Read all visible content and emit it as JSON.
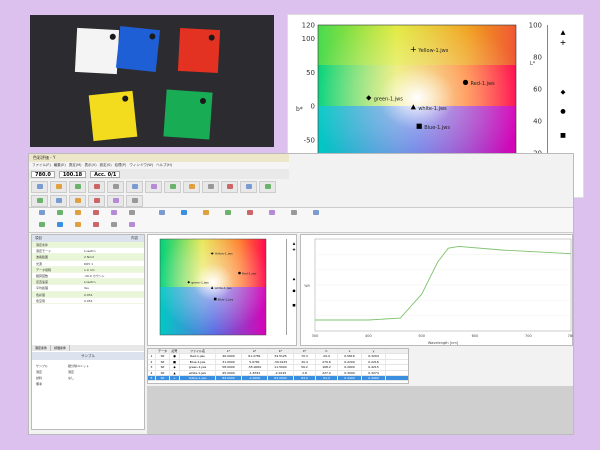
{
  "chips": [
    {
      "name": "white",
      "color": "#f4f4f4"
    },
    {
      "name": "blue",
      "color": "#1f5fd6"
    },
    {
      "name": "red",
      "color": "#e33222"
    },
    {
      "name": "yellow",
      "color": "#f3dc1e"
    },
    {
      "name": "green",
      "color": "#18ad55"
    }
  ],
  "big_chart": {
    "y_ticks": [
      "120",
      "100",
      "50",
      "0",
      "-50",
      "-100",
      "-120"
    ],
    "x_ticks": [
      "-120",
      "-100",
      "0",
      "100",
      "120"
    ],
    "y_label": "b*",
    "x_label": "a*",
    "l_label": "L*",
    "l_ticks": [
      "100",
      "80",
      "60",
      "40",
      "20",
      "0"
    ],
    "points": [
      {
        "label": "Yellow-1.jws",
        "a": -2,
        "b": 84,
        "marker": "plus",
        "L": 89
      },
      {
        "label": "Red-1.jws",
        "a": 60,
        "b": 35,
        "marker": "circle",
        "L": 46
      },
      {
        "label": "green-1.jws",
        "a": -55,
        "b": 12,
        "marker": "diamond",
        "L": 58
      },
      {
        "label": "white-1.jws",
        "a": -2,
        "b": -2,
        "marker": "triangle",
        "L": 95
      },
      {
        "label": "Blue-1.jws",
        "a": 5,
        "b": -30,
        "marker": "square",
        "L": 31
      }
    ]
  },
  "window": {
    "title": "色彩評価 - Y",
    "menu": [
      "ファイル(F)",
      "編集(E)",
      "測定(M)",
      "表示(V)",
      "設定(S)",
      "処理(P)",
      "ウィンドウ(W)",
      "ヘルプ(H)"
    ],
    "readout": {
      "wavelength": "780.0",
      "value": "100.18",
      "acc": "Acc. 0/1"
    },
    "left_panel": {
      "header_left": "項目",
      "header_right": "内容",
      "rows": [
        {
          "k": "測定条件",
          "v": ""
        },
        {
          "k": "測定モード",
          "v": "Lnsefcn"
        },
        {
          "k": "波長範囲",
          "v": "2 Nmd"
        },
        {
          "k": "光源",
          "v": "D65 1"
        },
        {
          "k": "データ間隔",
          "v": "1.0 nm"
        },
        {
          "k": "積算回数",
          "v": "-30.0 カウント"
        },
        {
          "k": "走査速度",
          "v": "Lnsefcn"
        },
        {
          "k": "平均処理",
          "v": "Yes"
        },
        {
          "k": "色彩値",
          "v": "0.051"
        },
        {
          "k": "色空間",
          "v": "0.051"
        }
      ],
      "tabs": [
        "測定条件",
        "評価条件"
      ],
      "sub_title": "サンプル",
      "info": [
        {
          "k": "サンプル",
          "v": "積分球ユニット"
        },
        {
          "k": "測定",
          "v": "測定"
        },
        {
          "k": "試料",
          "v": "なし"
        },
        {
          "k": "備考",
          "v": ""
        }
      ]
    },
    "spectrum": {
      "x_label": "Wavelength [nm]",
      "y_label": "%R",
      "x_ticks": [
        "300",
        "400",
        "500",
        "600",
        "700",
        "780"
      ],
      "curve_color": "#7fc36e"
    },
    "table": {
      "headers": [
        "",
        "データ",
        "記号",
        "ファイル名",
        "L*",
        "a*",
        "b*",
        "C*",
        "h",
        "x",
        "y"
      ],
      "rows": [
        [
          "1",
          "SP",
          "●",
          "Red-1.jws",
          "46.0000",
          "61.2781",
          "34.5125",
          "70.3",
          "29.4",
          "0.5616",
          "0.3294"
        ],
        [
          "2",
          "SP",
          "■",
          "Blue-1.jws",
          "31.0000",
          "5.0781",
          "-30.0125",
          "30.4",
          "279.6",
          "0.2200",
          "0.2216"
        ],
        [
          "3",
          "SP",
          "◆",
          "green-1.jws",
          "58.0000",
          "-55.0000",
          "11.5000",
          "56.2",
          "168.2",
          "0.2600",
          "0.4215"
        ],
        [
          "4",
          "SP",
          "▲",
          "white-1.jws",
          "95.0000",
          "-1.8781",
          "-2.0125",
          "2.8",
          "227.0",
          "0.3090",
          "0.3274"
        ],
        [
          "5",
          "SP",
          "+",
          "Yellow-1.jws",
          "89.0000",
          "-2.0000",
          "84.0000",
          "84.0",
          "91.4",
          "0.4400",
          "0.4900"
        ]
      ]
    }
  }
}
